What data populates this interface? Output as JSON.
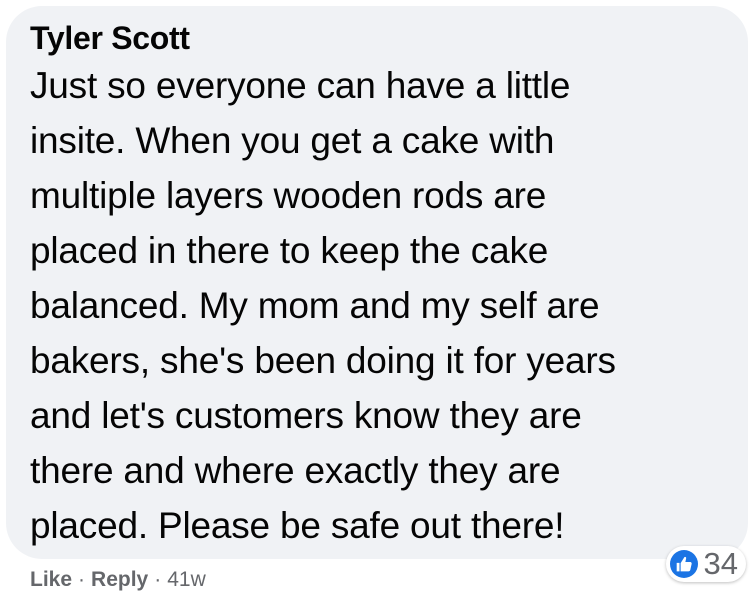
{
  "comment": {
    "author": "Tyler Scott",
    "text": "Just so everyone can have a little\ninsite. When you get a cake with\nmultiple layers wooden rods are\nplaced in there to keep the cake\nbalanced. My mom and my self are\nbakers, she's been doing it for years\nand let's customers know they are\nthere and where exactly they are\nplaced. Please be safe out there!",
    "reactions": {
      "icon": "like-icon",
      "count": "34",
      "color": "#1b74e4"
    },
    "actions": {
      "like_label": "Like",
      "reply_label": "Reply",
      "separator": "·",
      "timestamp": "41w"
    }
  }
}
